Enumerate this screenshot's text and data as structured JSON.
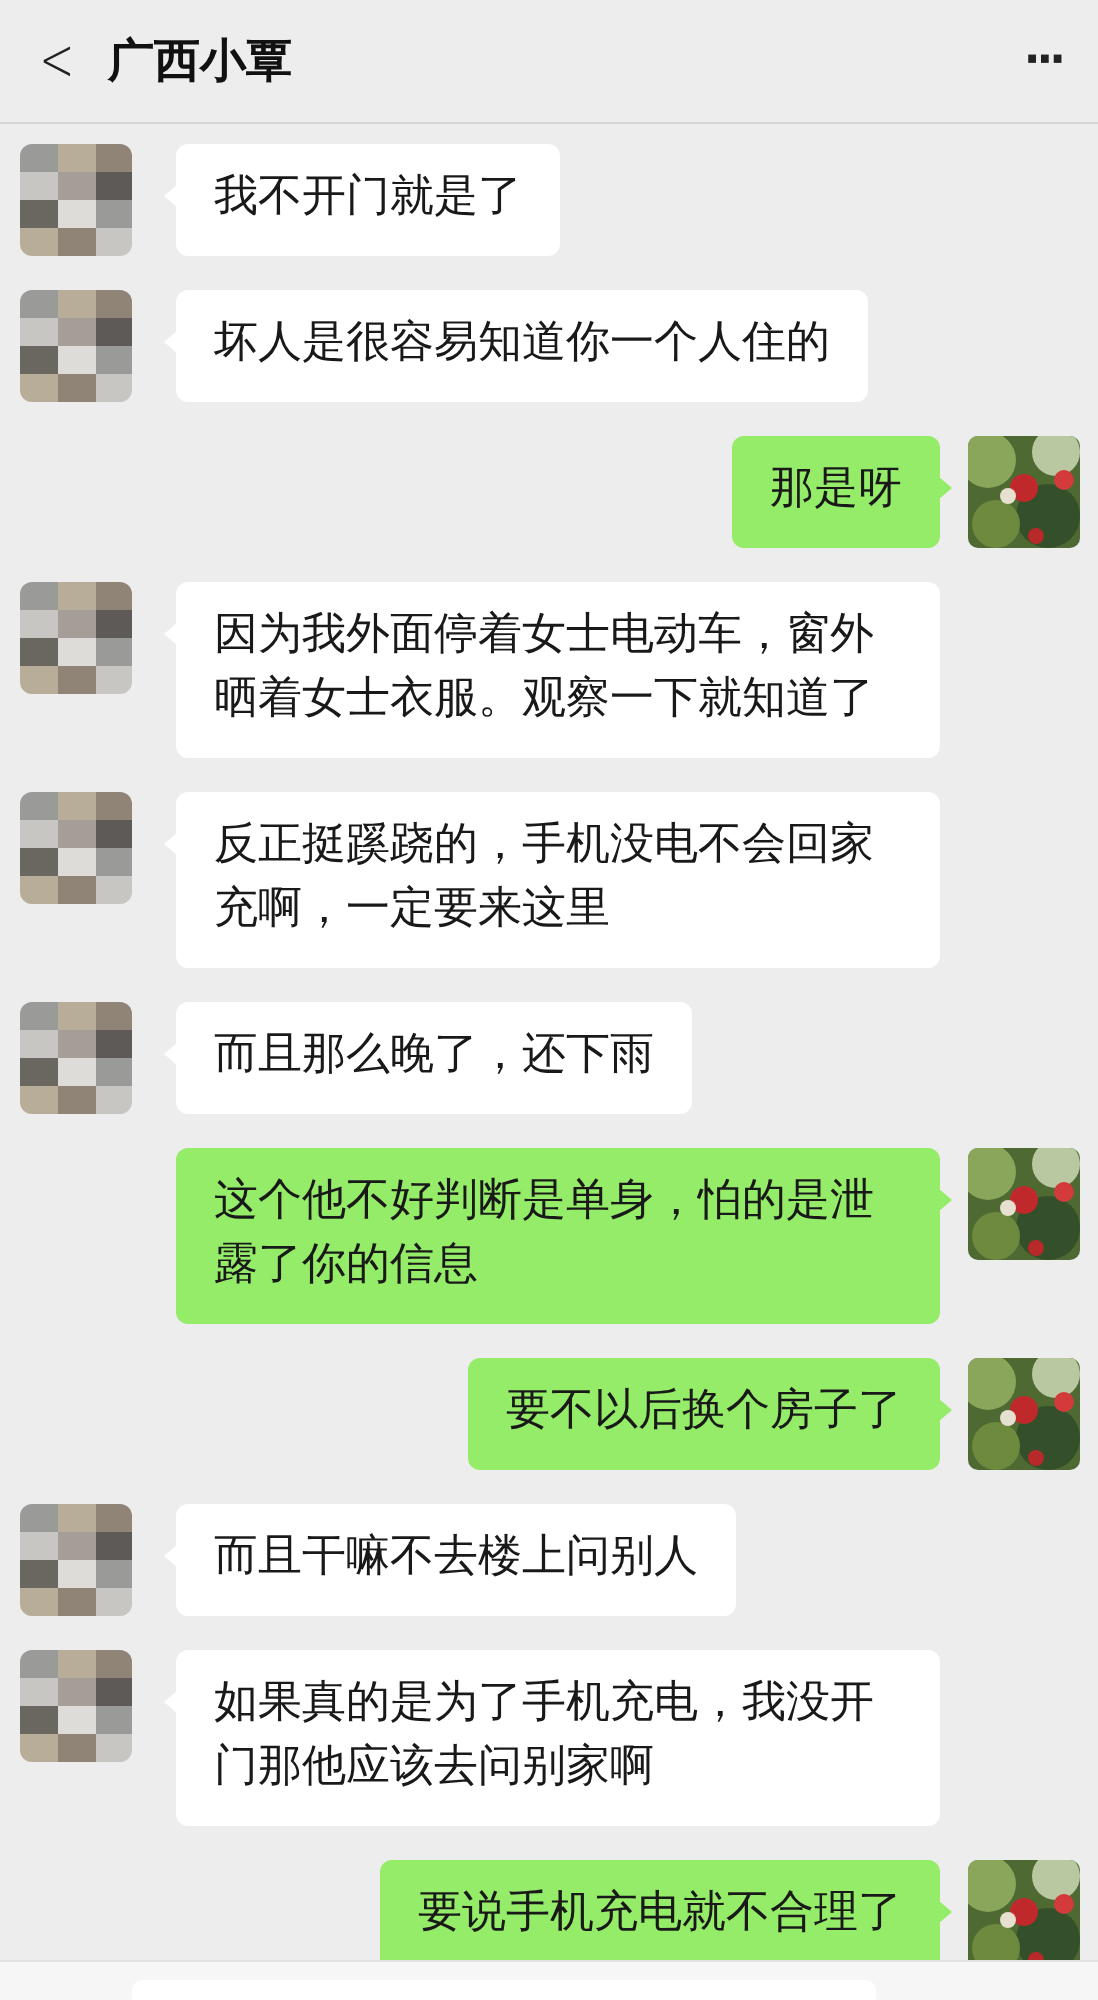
{
  "header": {
    "back": "<",
    "title": "广西小覃",
    "more": "···"
  },
  "messages": [
    {
      "kind": "incoming",
      "text": "我不开门就是了"
    },
    {
      "kind": "incoming",
      "text": "坏人是很容易知道你一个人住的"
    },
    {
      "kind": "outgoing",
      "text": "那是呀"
    },
    {
      "kind": "incoming",
      "text": "因为我外面停着女士电动车，窗外晒着女士衣服。观察一下就知道了"
    },
    {
      "kind": "incoming",
      "text": "反正挺蹊跷的，手机没电不会回家充啊，一定要来这里"
    },
    {
      "kind": "incoming",
      "text": "而且那么晚了，还下雨"
    },
    {
      "kind": "outgoing",
      "text": "这个他不好判断是单身，怕的是泄露了你的信息"
    },
    {
      "kind": "outgoing",
      "text": "要不以后换个房子了"
    },
    {
      "kind": "incoming",
      "text": "而且干嘛不去楼上问别人"
    },
    {
      "kind": "incoming",
      "text": "如果真的是为了手机充电，我没开门那他应该去问别家啊"
    },
    {
      "kind": "outgoing",
      "text": "要说手机充电就不合理了"
    }
  ]
}
